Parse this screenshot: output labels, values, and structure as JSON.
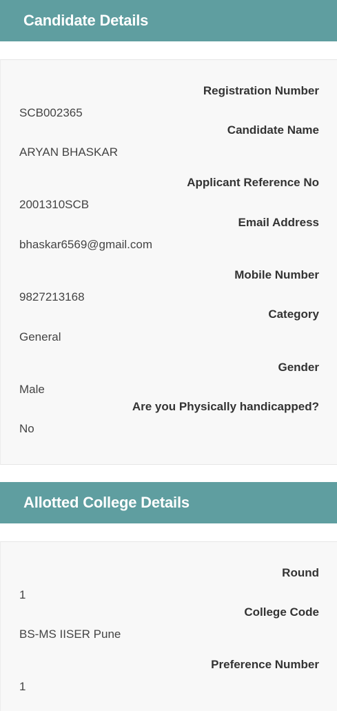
{
  "candidate_section": {
    "title": "Candidate Details",
    "fields": [
      {
        "label": "Registration Number",
        "value": "SCB002365"
      },
      {
        "label": "Candidate Name",
        "value": "ARYAN BHASKAR"
      },
      {
        "label": "Applicant Reference No",
        "value": "2001310SCB"
      },
      {
        "label": "Email Address",
        "value": "bhaskar6569@gmail.com"
      },
      {
        "label": "Mobile Number",
        "value": "9827213168"
      },
      {
        "label": "Category",
        "value": "General"
      },
      {
        "label": "Gender",
        "value": "Male"
      },
      {
        "label": "Are you Physically handicapped?",
        "value": "No"
      }
    ]
  },
  "college_section": {
    "title": "Allotted College Details",
    "fields": [
      {
        "label": "Round",
        "value": "1"
      },
      {
        "label": "College Code",
        "value": "BS-MS IISER Pune"
      },
      {
        "label": "Preference Number",
        "value": "1"
      }
    ]
  }
}
